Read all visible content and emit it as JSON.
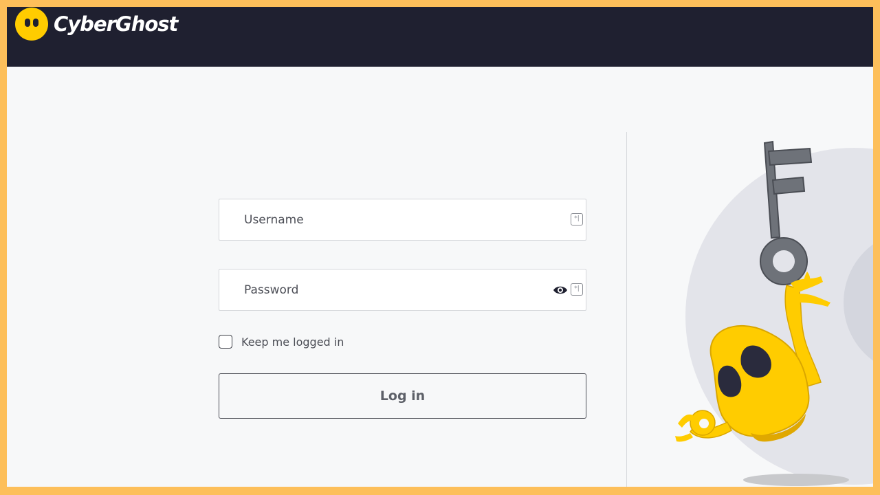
{
  "header": {
    "brand": "CyberGhost"
  },
  "login_form": {
    "username_placeholder": "Username",
    "password_placeholder": "Password",
    "remember_label": "Keep me logged in",
    "submit_label": "Log in"
  },
  "icons": {
    "username_field": "keyboard-icon",
    "password_field": [
      "eye-icon",
      "keyboard-icon"
    ]
  },
  "colors": {
    "frame_border": "#fdbf5a",
    "header_bg": "#1f2030",
    "brand_yellow": "#ffcc00",
    "page_bg": "#f7f8f9"
  }
}
